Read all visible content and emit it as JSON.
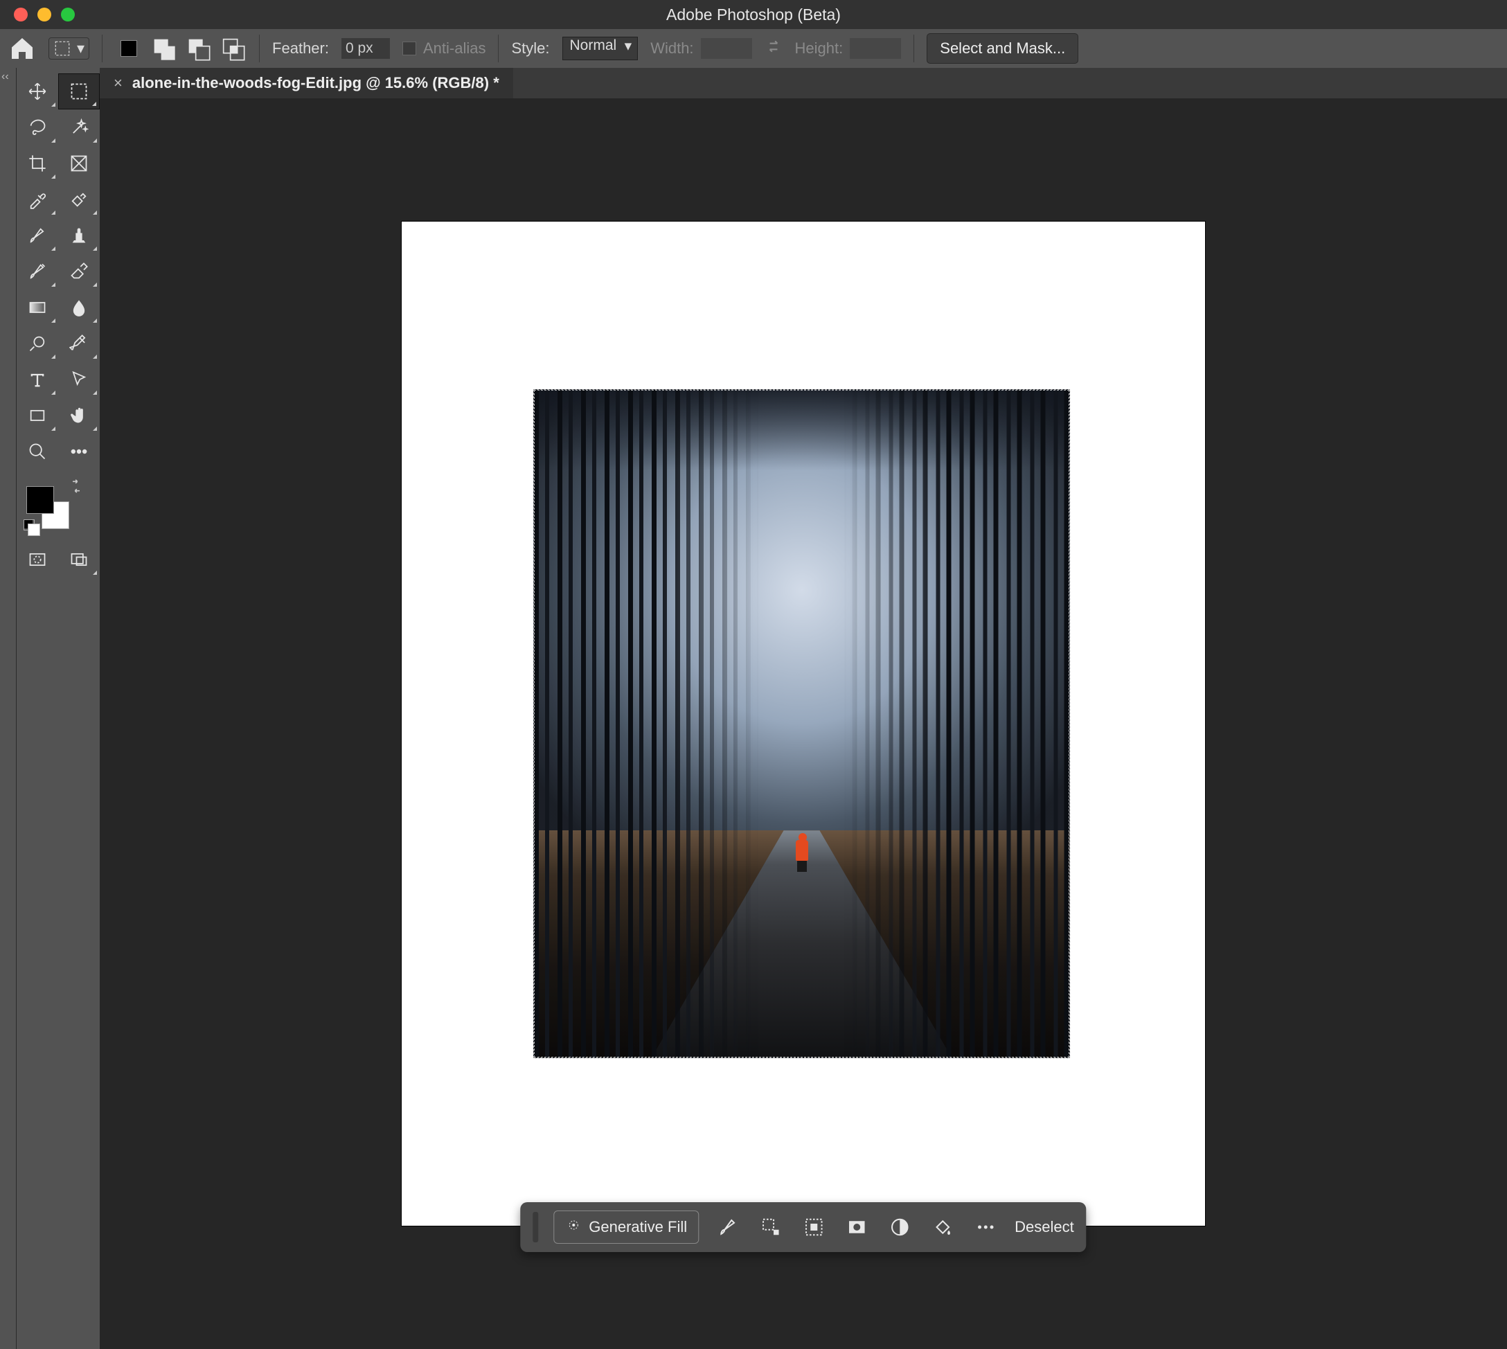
{
  "app": {
    "title": "Adobe Photoshop (Beta)"
  },
  "options_bar": {
    "feather_label": "Feather:",
    "feather_value": "0 px",
    "antialias_label": "Anti-alias",
    "style_label": "Style:",
    "style_value": "Normal",
    "width_label": "Width:",
    "height_label": "Height:",
    "select_mask": "Select and Mask..."
  },
  "document": {
    "tab_title": "alone-in-the-woods-fog-Edit.jpg @ 15.6% (RGB/8) *"
  },
  "context_bar": {
    "generative_fill": "Generative Fill",
    "deselect": "Deselect"
  },
  "tools": {
    "left_column": [
      "move",
      "lasso",
      "crop",
      "eyedropper",
      "brush",
      "clone",
      "gradient",
      "dodge",
      "text",
      "rectangle",
      "zoom"
    ],
    "right_column": [
      "marquee",
      "wand",
      "frame",
      "ruler",
      "stamp",
      "heal",
      "blur",
      "pen",
      "path",
      "hand",
      "more"
    ]
  }
}
